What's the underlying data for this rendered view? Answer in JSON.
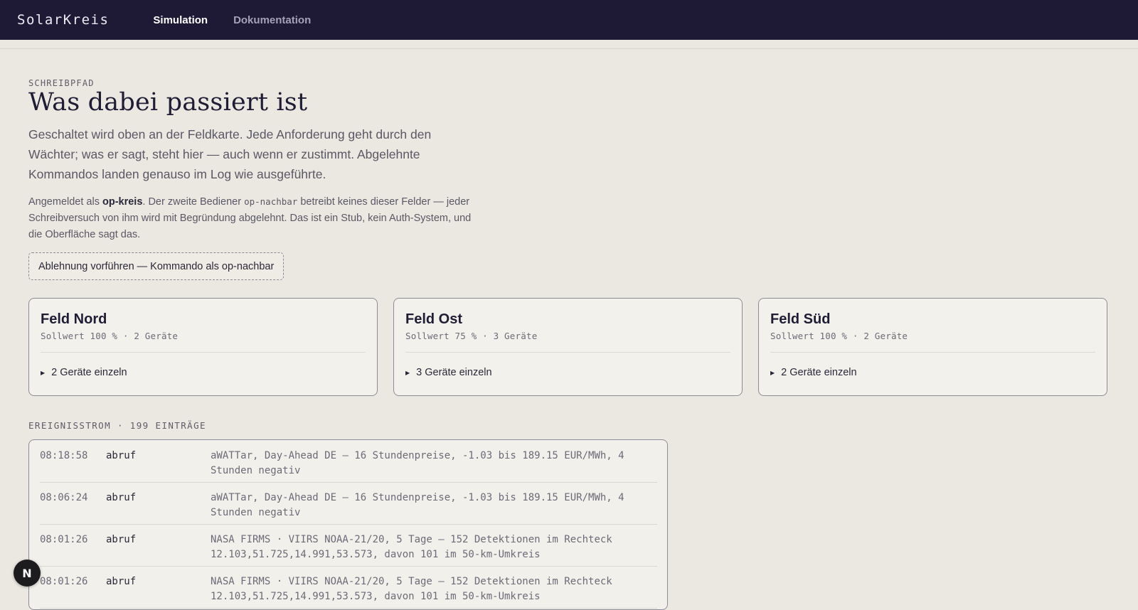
{
  "app": {
    "brand": "SolarKreis",
    "nav": [
      {
        "label": "Simulation",
        "active": true
      },
      {
        "label": "Dokumentation",
        "active": false
      }
    ]
  },
  "header": {
    "eyebrow": "SCHREIBPFAD",
    "title": "Was dabei passiert ist",
    "lead": "Geschaltet wird oben an der Feldkarte. Jede Anforderung geht durch den Wächter; was er sagt, steht hier — auch wenn er zustimmt. Abgelehnte Kommandos landen genauso im Log wie ausgeführte."
  },
  "session": {
    "prefix": "Angemeldet als ",
    "user": "op-kreis",
    "middle": ". Der zweite Bediener ",
    "second_user": "op-nachbar",
    "suffix": " betreibt keines dieser Felder — jeder Schreibversuch von ihm wird mit Begründung abgelehnt. Das ist ein Stub, kein Auth-System, und die Oberfläche sagt das.",
    "demo_button": "Ablehnung vorführen — Kommando als op-nachbar"
  },
  "fields": [
    {
      "name": "Feld Nord",
      "meta": "Sollwert 100 % · 2 Geräte",
      "toggle": "2 Geräte einzeln"
    },
    {
      "name": "Feld Ost",
      "meta": "Sollwert 75 % · 3 Geräte",
      "toggle": "3 Geräte einzeln"
    },
    {
      "name": "Feld Süd",
      "meta": "Sollwert 100 % · 2 Geräte",
      "toggle": "2 Geräte einzeln"
    }
  ],
  "stream": {
    "label": "EREIGNISSTROM · 199 EINTRÄGE",
    "rows": [
      {
        "time": "08:18:58",
        "kind": "abruf",
        "text": "aWATTar, Day-Ahead DE — 16 Stundenpreise, -1.03 bis 189.15 EUR/MWh, 4 Stunden negativ"
      },
      {
        "time": "08:06:24",
        "kind": "abruf",
        "text": "aWATTar, Day-Ahead DE — 16 Stundenpreise, -1.03 bis 189.15 EUR/MWh, 4 Stunden negativ"
      },
      {
        "time": "08:01:26",
        "kind": "abruf",
        "text": "NASA FIRMS · VIIRS NOAA-21/20, 5 Tage — 152 Detektionen im Rechteck 12.103,51.725,14.991,53.573, davon 101 im 50-km-Umkreis"
      },
      {
        "time": "08:01:26",
        "kind": "abruf",
        "text": "NASA FIRMS · VIIRS NOAA-21/20, 5 Tage — 152 Detektionen im Rechteck 12.103,51.725,14.991,53.573, davon 101 im 50-km-Umkreis"
      }
    ]
  },
  "fab": {
    "label": "N"
  }
}
